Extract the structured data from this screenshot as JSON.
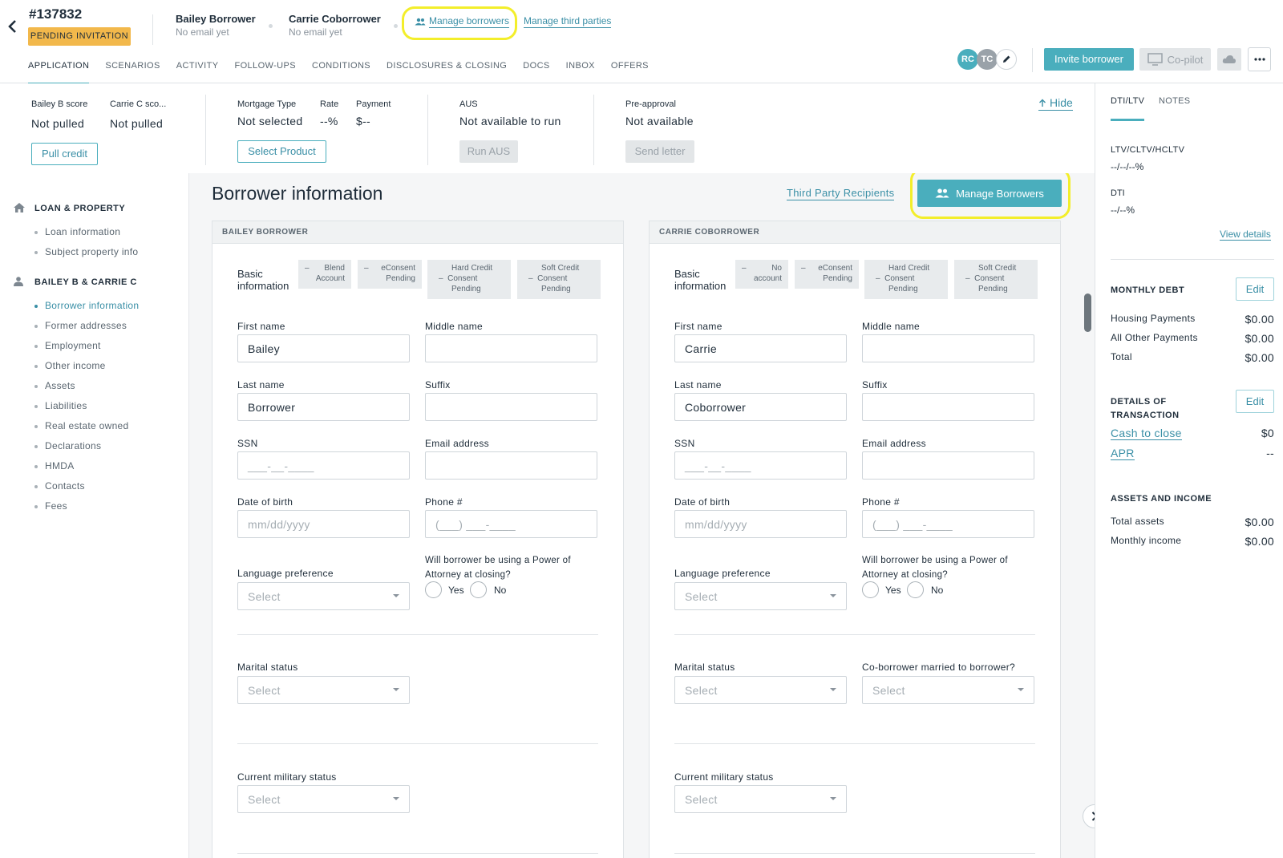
{
  "header": {
    "loan_id": "#137832",
    "status_badge": "PENDING INVITATION",
    "borrowers": [
      {
        "name": "Bailey Borrower",
        "sub": "No email yet"
      },
      {
        "name": "Carrie Coborrower",
        "sub": "No email yet"
      }
    ],
    "manage_borrowers_link": "Manage borrowers",
    "manage_third_parties_link": "Manage third parties",
    "tabs": [
      "APPLICATION",
      "SCENARIOS",
      "ACTIVITY",
      "FOLLOW-UPS",
      "CONDITIONS",
      "DISCLOSURES & CLOSING",
      "DOCS",
      "INBOX",
      "OFFERS"
    ],
    "avatars": [
      "RC",
      "TC"
    ],
    "invite_label": "Invite borrower",
    "copilot_label": "Co-pilot",
    "accent": "#4aaebd",
    "highlight": "#f3ee2b"
  },
  "summary": {
    "bailey_score_label": "Bailey B score",
    "bailey_score_value": "Not pulled",
    "carrie_score_label": "Carrie C sco...",
    "carrie_score_value": "Not pulled",
    "pull_credit": "Pull credit",
    "mortgage_type_label": "Mortgage Type",
    "mortgage_type_value": "Not selected",
    "rate_label": "Rate",
    "rate_value": "--%",
    "payment_label": "Payment",
    "payment_value": "$--",
    "select_product": "Select Product",
    "aus_label": "AUS",
    "aus_value": "Not available to run",
    "run_aus": "Run AUS",
    "preapproval_label": "Pre-approval",
    "preapproval_value": "Not available",
    "send_letter": "Send letter",
    "hide": "Hide"
  },
  "sidebar": {
    "section1": "LOAN & PROPERTY",
    "section1_items": [
      "Loan information",
      "Subject property info"
    ],
    "section2": "BAILEY B & CARRIE C",
    "section2_items": [
      "Borrower information",
      "Former addresses",
      "Employment",
      "Other income",
      "Assets",
      "Liabilities",
      "Real estate owned",
      "Declarations",
      "HMDA",
      "Contacts",
      "Fees"
    ]
  },
  "main": {
    "title": "Borrower information",
    "third_party_link": "Third Party Recipients",
    "manage_borrowers_btn": "Manage Borrowers",
    "cards": [
      {
        "header": "BAILEY BORROWER",
        "section_title_1": "Basic",
        "section_title_2": "information",
        "chips": [
          [
            "Blend",
            "Account"
          ],
          [
            "eConsent",
            "Pending"
          ],
          [
            "Hard Credit",
            "Consent",
            "Pending"
          ],
          [
            "Soft Credit",
            "Consent",
            "Pending"
          ]
        ],
        "first_name_label": "First name",
        "first_name": "Bailey",
        "middle_name_label": "Middle name",
        "last_name_label": "Last name",
        "last_name": "Borrower",
        "suffix_label": "Suffix",
        "ssn_label": "SSN",
        "ssn_placeholder": "___-__-____",
        "email_label": "Email address",
        "dob_label": "Date of birth",
        "dob_placeholder": "mm/dd/yyyy",
        "phone_label": "Phone #",
        "phone_placeholder": "(___) ___-____",
        "language_label": "Language preference",
        "language_value": "Select",
        "poa_question_1": "Will borrower be using a Power of",
        "poa_question_2": "Attorney at closing?",
        "yes": "Yes",
        "no": "No",
        "marital_label": "Marital status",
        "marital_value": "Select",
        "military_label": "Current military status",
        "military_value": "Select"
      },
      {
        "header": "CARRIE COBORROWER",
        "section_title_1": "Basic",
        "section_title_2": "information",
        "chips": [
          [
            "No",
            "account"
          ],
          [
            "eConsent",
            "Pending"
          ],
          [
            "Hard Credit",
            "Consent",
            "Pending"
          ],
          [
            "Soft Credit",
            "Consent",
            "Pending"
          ]
        ],
        "first_name_label": "First name",
        "first_name": "Carrie",
        "middle_name_label": "Middle name",
        "last_name_label": "Last name",
        "last_name": "Coborrower",
        "suffix_label": "Suffix",
        "ssn_label": "SSN",
        "ssn_placeholder": "___-__-____",
        "email_label": "Email address",
        "dob_label": "Date of birth",
        "dob_placeholder": "mm/dd/yyyy",
        "phone_label": "Phone #",
        "phone_placeholder": "(___) ___-____",
        "language_label": "Language preference",
        "language_value": "Select",
        "poa_question_1": "Will borrower be using a Power of",
        "poa_question_2": "Attorney at closing?",
        "yes": "Yes",
        "no": "No",
        "marital_label": "Marital status",
        "marital_value": "Select",
        "married_label": "Co-borrower married to borrower?",
        "married_value": "Select",
        "military_label": "Current military status",
        "military_value": "Select"
      }
    ]
  },
  "right": {
    "tab_dti": "DTI/LTV",
    "tab_notes": "NOTES",
    "ltv_label": "LTV/CLTV/HCLTV",
    "ltv_value": "--/--/--%",
    "dti_label": "DTI",
    "dti_value": "--/--%",
    "view_details": "View details",
    "monthly_debt": "MONTHLY DEBT",
    "edit": "Edit",
    "housing_label": "Housing Payments",
    "housing_value": "$0.00",
    "other_label": "All Other Payments",
    "other_value": "$0.00",
    "total_label": "Total",
    "total_value": "$0.00",
    "details_1": "DETAILS OF",
    "details_2": "TRANSACTION",
    "cash_label": "Cash to close",
    "cash_value": "$0",
    "apr_label": "APR",
    "apr_value": "--",
    "assets_head": "ASSETS AND INCOME",
    "total_assets_label": "Total assets",
    "total_assets_value": "$0.00",
    "monthly_income_label": "Monthly income",
    "monthly_income_value": "$0.00"
  }
}
